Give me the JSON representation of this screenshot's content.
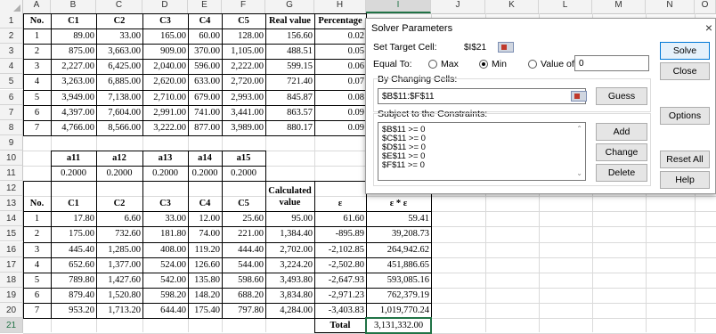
{
  "columns": [
    "A",
    "B",
    "C",
    "D",
    "E",
    "F",
    "G",
    "H",
    "I",
    "J",
    "K",
    "L",
    "M",
    "N",
    "O"
  ],
  "rows": [
    "1",
    "2",
    "3",
    "4",
    "5",
    "6",
    "7",
    "8",
    "9",
    "10",
    "11",
    "12",
    "13",
    "14",
    "15",
    "16",
    "17",
    "18",
    "19",
    "20",
    "21"
  ],
  "table1": {
    "headers": [
      "No.",
      "C1",
      "C2",
      "C3",
      "C4",
      "C5",
      "Real value",
      "Percentage"
    ],
    "data": [
      [
        "1",
        "89.00",
        "33.00",
        "165.00",
        "60.00",
        "128.00",
        "156.60",
        "0.02"
      ],
      [
        "2",
        "875.00",
        "3,663.00",
        "909.00",
        "370.00",
        "1,105.00",
        "488.51",
        "0.05"
      ],
      [
        "3",
        "2,227.00",
        "6,425.00",
        "2,040.00",
        "596.00",
        "2,222.00",
        "599.15",
        "0.06"
      ],
      [
        "4",
        "3,263.00",
        "6,885.00",
        "2,620.00",
        "633.00",
        "2,720.00",
        "721.40",
        "0.07"
      ],
      [
        "5",
        "3,949.00",
        "7,138.00",
        "2,710.00",
        "679.00",
        "2,993.00",
        "845.87",
        "0.08"
      ],
      [
        "6",
        "4,397.00",
        "7,604.00",
        "2,991.00",
        "741.00",
        "3,441.00",
        "863.57",
        "0.09"
      ],
      [
        "7",
        "4,766.00",
        "8,566.00",
        "3,222.00",
        "877.00",
        "3,989.00",
        "880.17",
        "0.09"
      ]
    ]
  },
  "table2": {
    "headers": [
      "a11",
      "a12",
      "a13",
      "a14",
      "a15"
    ],
    "values": [
      "0.2000",
      "0.2000",
      "0.2000",
      "0.2000",
      "0.2000"
    ]
  },
  "table3": {
    "headers": [
      "No.",
      "C1",
      "C2",
      "C3",
      "C4",
      "C5",
      "Calculated value",
      "ε",
      "ε * ε"
    ],
    "header_calc_line1": "Calculated",
    "header_calc_line2": "value",
    "data": [
      [
        "1",
        "17.80",
        "6.60",
        "33.00",
        "12.00",
        "25.60",
        "95.00",
        "61.60",
        "59.41"
      ],
      [
        "2",
        "175.00",
        "732.60",
        "181.80",
        "74.00",
        "221.00",
        "1,384.40",
        "-895.89",
        "39,208.73"
      ],
      [
        "3",
        "445.40",
        "1,285.00",
        "408.00",
        "119.20",
        "444.40",
        "2,702.00",
        "-2,102.85",
        "264,942.62"
      ],
      [
        "4",
        "652.60",
        "1,377.00",
        "524.00",
        "126.60",
        "544.00",
        "3,224.20",
        "-2,502.80",
        "451,886.65"
      ],
      [
        "5",
        "789.80",
        "1,427.60",
        "542.00",
        "135.80",
        "598.60",
        "3,493.80",
        "-2,647.93",
        "593,085.16"
      ],
      [
        "6",
        "879.40",
        "1,520.80",
        "598.20",
        "148.20",
        "688.20",
        "3,834.80",
        "-2,971.23",
        "762,379.19"
      ],
      [
        "7",
        "953.20",
        "1,713.20",
        "644.40",
        "175.40",
        "797.80",
        "4,284.00",
        "-3,403.83",
        "1,019,770.24"
      ]
    ],
    "total_label": "Total",
    "total_value": "3,131,332.00"
  },
  "dialog": {
    "title": "Solver Parameters",
    "close": "×",
    "set_target_label": "Set Target Cell:",
    "target_value": "$I$21",
    "equal_to_label": "Equal To:",
    "opt_max": "Max",
    "opt_min": "Min",
    "opt_value": "Value of:",
    "value_of": "0",
    "selected": "Min",
    "changing_cells_label": "By Changing Cells:",
    "changing_cells_value": "$B$11:$F$11",
    "guess": "Guess",
    "constraints_label": "Subject to the Constraints:",
    "constraints": [
      "$B$11 >= 0",
      "$C$11 >= 0",
      "$D$11 >= 0",
      "$E$11 >= 0",
      "$F$11 >= 0"
    ],
    "add": "Add",
    "change": "Change",
    "delete": "Delete",
    "solve": "Solve",
    "close_btn": "Close",
    "options": "Options",
    "reset_all": "Reset All",
    "help": "Help"
  }
}
